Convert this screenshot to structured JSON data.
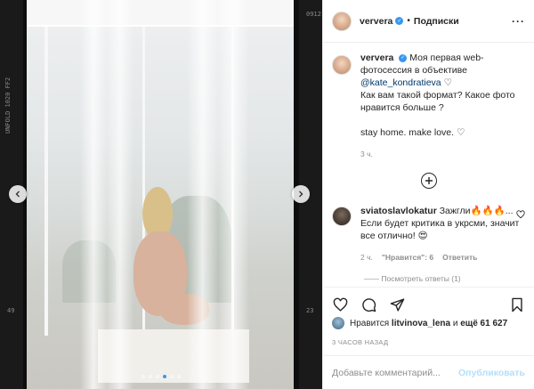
{
  "post": {
    "username": "ververa",
    "follow_label": "Подписки",
    "separator": "•",
    "more_label": "···"
  },
  "film": {
    "left_top": "UNFOLD 1020 FF2",
    "left_bottom": "49",
    "right_top": "0912",
    "right_bottom": "23"
  },
  "carousel": {
    "slide_count": 6,
    "active_index": 3
  },
  "caption": {
    "username": "ververa",
    "line1": "Моя первая web-фотосессия в объективе",
    "mention": "@kate_kondratieva",
    "heart": "♡",
    "line2": "Как вам такой формат? Какое фото нравится больше ?",
    "line3": "stay home. make love.",
    "time": "3 ч."
  },
  "comment": {
    "username": "sviatoslavlokatur",
    "text": "Зажгли🔥🔥🔥... Если будет критика в укрсми, значит все отлично! 😍",
    "time": "2 ч.",
    "likes": "\"Нравится\": 6",
    "reply": "Ответить",
    "view_replies": "—— Посмотреть ответы (1)"
  },
  "likes": {
    "prefix": "Нравится",
    "user": "litvinova_lena",
    "middle": "и",
    "others": "ещё 61 627"
  },
  "timestamp": "3 ЧАСОВ НАЗАД",
  "comment_input": {
    "placeholder": "Добавьте комментарий...",
    "publish_label": "Опубликовать"
  },
  "colors": {
    "accent": "#3897f0",
    "publish_disabled": "#b2dffc",
    "muted": "#8e8e8e"
  }
}
